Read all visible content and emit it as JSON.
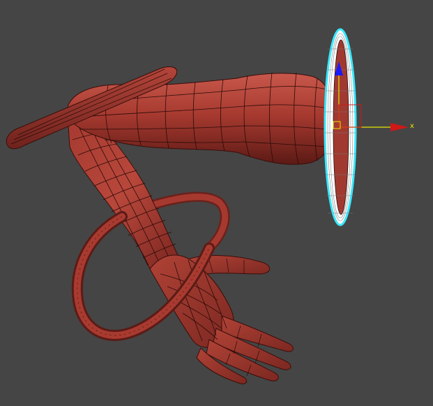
{
  "viewport": {
    "background": "#454545",
    "mesh_color": "#a83a30",
    "mesh_highlight": "#c65a4d",
    "mesh_shadow": "#5e1a16",
    "wire_color": "#2a0a08",
    "selection_color": "#38e8ff",
    "selected_object": "torus-ring",
    "gizmo": {
      "x_axis_color": "#d01818",
      "y_axis_color": "#1a1aff",
      "z_axis_color": "#e6e600",
      "x_label": "x"
    }
  }
}
